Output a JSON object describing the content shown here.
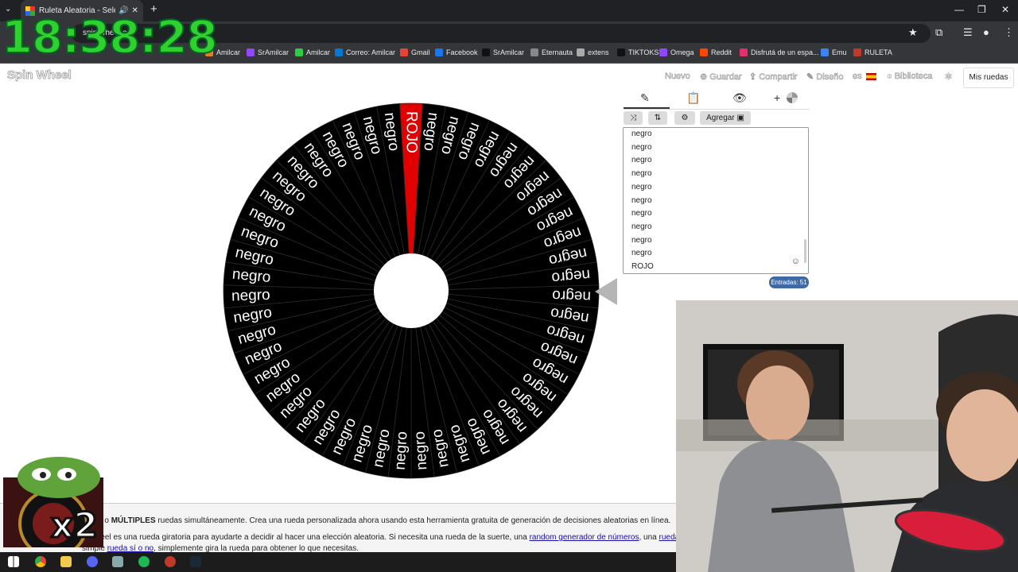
{
  "browser": {
    "tab_title": "Ruleta Aleatoria - Selector",
    "omnibox_text": "spin wheel.es",
    "bookmarks": [
      {
        "label": "Amilcar",
        "color": "#e67e22"
      },
      {
        "label": "SrAmilcar",
        "color": "#9146ff"
      },
      {
        "label": "Amilcar",
        "color": "#2ecc40"
      },
      {
        "label": "Correo: Amilcar",
        "color": "#0078d4"
      },
      {
        "label": "Gmail",
        "color": "#ea4335"
      },
      {
        "label": "Facebook",
        "color": "#1877f2"
      },
      {
        "label": "SrAmilcar",
        "color": "#111111"
      },
      {
        "label": "Eternauta",
        "color": "#888888"
      },
      {
        "label": "extens",
        "color": "#aaaaaa"
      },
      {
        "label": "TIKTOKS",
        "color": "#111111"
      },
      {
        "label": "Omega",
        "color": "#9146ff"
      },
      {
        "label": "Reddit",
        "color": "#ff4500"
      },
      {
        "label": "Disfrutá de un espa...",
        "color": "#e1306c"
      },
      {
        "label": "Emu",
        "color": "#3b82f6"
      },
      {
        "label": "RULETA",
        "color": "#c0392b"
      }
    ]
  },
  "overlay": {
    "clock": "18:38:28",
    "emote_text": "x2"
  },
  "site": {
    "logo": "Spin Wheel",
    "nav": {
      "nuevo": "Nuevo",
      "guardar": "Guardar",
      "compartir": "Compartir",
      "diseno": "Diseño",
      "lang": "es",
      "biblioteca": "Biblioteca",
      "mis_ruedas": "Mis ruedas"
    }
  },
  "editor": {
    "tabs": [
      {
        "icon": "pencil-icon",
        "glyph": "✎",
        "active": true
      },
      {
        "icon": "clipboard-icon",
        "glyph": "📋",
        "active": false
      },
      {
        "icon": "eye-off-icon",
        "glyph": "👁",
        "active": false
      },
      {
        "icon": "add-wheel-icon",
        "glyph": "+",
        "active": false
      }
    ],
    "buttons": {
      "agregar": "Agregar"
    },
    "visible_entries": [
      "negro",
      "negro",
      "negro",
      "negro",
      "negro",
      "negro",
      "negro",
      "negro",
      "negro",
      "negro",
      "ROJO"
    ],
    "count_label": "Entradas: 51"
  },
  "wheel": {
    "segment_count": 51,
    "red_index": 0,
    "red_label": "ROJO",
    "default_label": "negro",
    "colors": {
      "black": "#000000",
      "red": "#e00000",
      "divider": "#2a2a2a",
      "text": "#ffffff"
    }
  },
  "description": {
    "line1_pre": "rueda o",
    "line1_bold": "MÚLTIPLES",
    "line1_post": "ruedas simultáneamente. Crea una rueda personalizada ahora usando esta herramienta gratuita de generación de decisiones aleatorias en línea.",
    "line2_pre": "e Wheel es una rueda giratoria para ayudarte a decidir al hacer una elección aleatoria. Si necesita una rueda de la suerte, una",
    "line2_link1": "random generador de números",
    "line2_mid": ", una",
    "line2_link2": "rueda de nor",
    "line3_pre": "simple",
    "line3_link": "rueda sí o no",
    "line3_post": ", simplemente gira la rueda para obtener lo que necesitas."
  }
}
